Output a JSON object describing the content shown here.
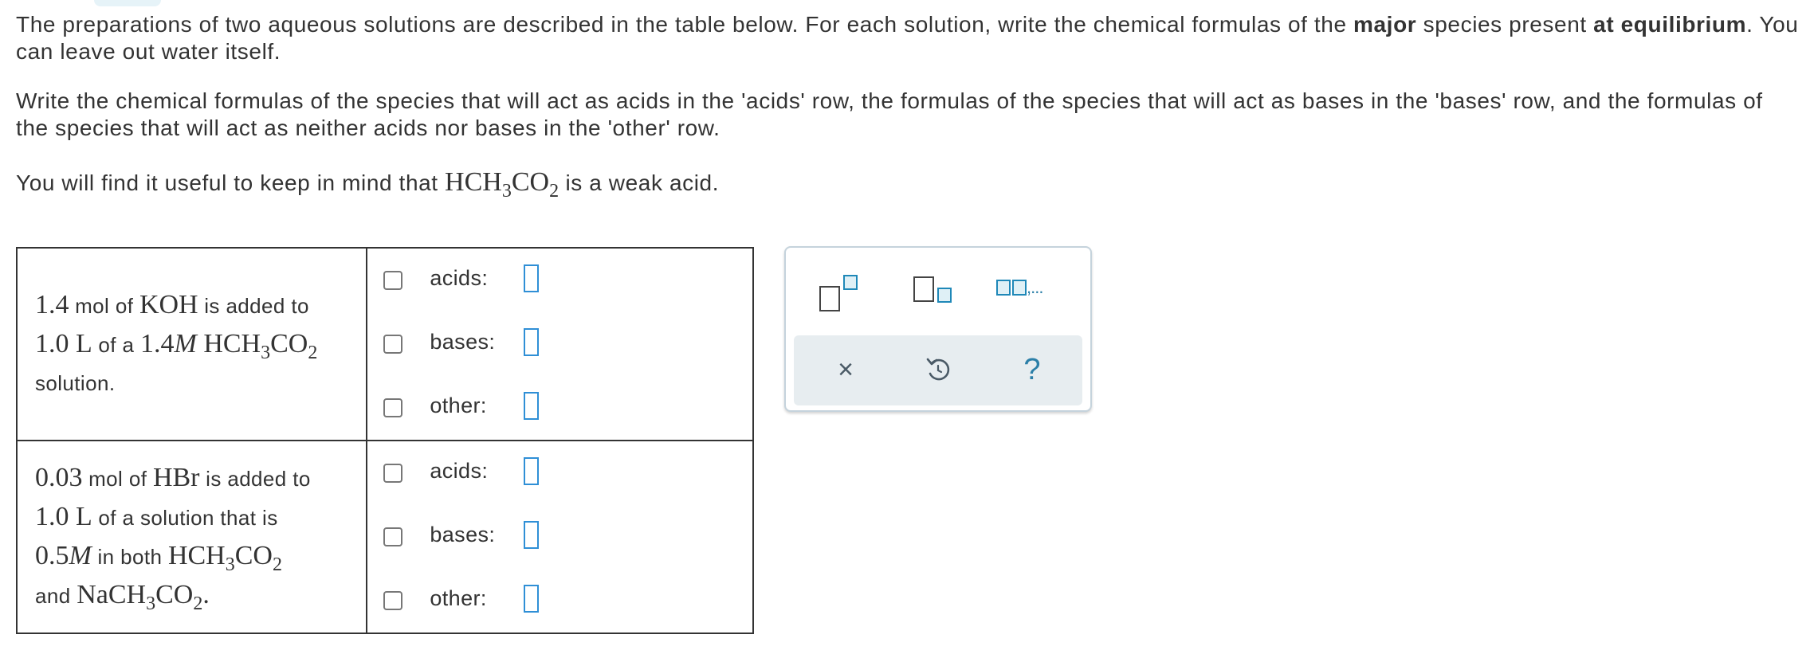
{
  "intro": {
    "p1_part1": "The preparations of two aqueous solutions are described in the table below. For each solution, write the chemical formulas of the ",
    "p1_bold1": "major",
    "p1_part2": " species present ",
    "p1_bold2": "at equilibrium",
    "p1_part3": ". You can leave out water itself.",
    "p2": "Write the chemical formulas of the species that will act as acids in the 'acids' row, the formulas of the species that will act as bases in the 'bases' row, and the formulas of the species that will act as neither acids nor bases in the 'other' row.",
    "p3_before": "You will find it useful to keep in mind that ",
    "p3_formula_a": "HCH",
    "p3_formula_sub1": "3",
    "p3_formula_b": "CO",
    "p3_formula_sub2": "2",
    "p3_after": " is a weak acid."
  },
  "problems": [
    {
      "amount": "1.4",
      "unit_mol": " mol of ",
      "substance": "KOH",
      "text_added_to": " is added to",
      "volume": "1.0 L",
      "text_of_a": " of a ",
      "conc": "1.4",
      "molar": "M",
      "acid_a": "HCH",
      "acid_sub1": "3",
      "acid_b": "CO",
      "acid_sub2": "2",
      "text_end": "solution."
    },
    {
      "amount": "0.03",
      "unit_mol": " mol of ",
      "substance": "HBr",
      "text_added_to": " is added to",
      "volume": "1.0 L",
      "text_of_a": " of a solution that is",
      "conc": "0.5",
      "molar": "M",
      "text_in_both": " in both ",
      "acid_a": "HCH",
      "acid_sub1": "3",
      "acid_b": "CO",
      "acid_sub2": "2",
      "text_and": "and ",
      "salt_a": "NaCH",
      "salt_sub1": "3",
      "salt_b": "CO",
      "salt_sub2": "2",
      "salt_end": "."
    }
  ],
  "answer_labels": {
    "acids": "acids:",
    "bases": "bases:",
    "other": "other:"
  },
  "palette": {
    "list_template_text": ",...",
    "clear_symbol": "×",
    "help_symbol": "?",
    "icons": [
      "superscript-template-icon",
      "subscript-template-icon",
      "list-template-icon",
      "clear-icon",
      "undo-icon",
      "help-icon"
    ]
  },
  "colors": {
    "accent": "#1f88b8",
    "answer_box": "#2f8fd6",
    "action_bar": "#e7edf0"
  }
}
